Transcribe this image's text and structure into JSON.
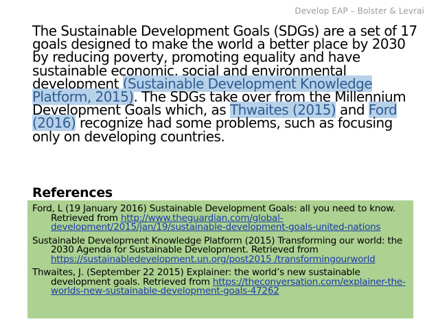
{
  "header": {
    "text": "Develop EAP – Bolster & Levrai"
  },
  "paragraph": {
    "p1": "The Sustainable Development Goals (SDGs) are a set of 17 goals designed to make the world a better place by 2030 by reducing poverty, promoting equality and have sustainable economic, social and environmental development ",
    "cite1": "(Sustainable Development Knowledge Platform, 2015)",
    "p2": ". The SDGs take over from the Millennium Development Goals which, as ",
    "cite2": "Thwaites (2015)",
    "p3": " and ",
    "cite3": "Ford (2016)",
    "p4": " recognize had some problems, such as focusing only on developing countries."
  },
  "references": {
    "title": "References",
    "items": [
      {
        "text": "Ford, L (19 January 2016) Sustainable Development Goals: all you need to know. Retrieved from ",
        "link": "http://www.theguardian.com/global-development/2015/jan/19/sustainable-development-goals-united-nations"
      },
      {
        "text": "Sustainable Development Knowledge Platform (2015) Transforming our world: the 2030 Agenda for Sustainable Development. Retrieved from ",
        "link": "https://sustainabledevelopment.un.org/post2015 /transformingourworld"
      },
      {
        "text": "Thwaites, J. (September 22 2015) Explainer: the world’s new sustainable development goals. Retrieved from ",
        "link": "https://theconversation.com/explainer-the-worlds-new-sustainable-development-goals-47262"
      }
    ]
  },
  "colors": {
    "highlight": "#b8d1ea",
    "citation_text": "#2f5c8f",
    "references_bg": "#acd191",
    "link": "#1a3aa8"
  }
}
